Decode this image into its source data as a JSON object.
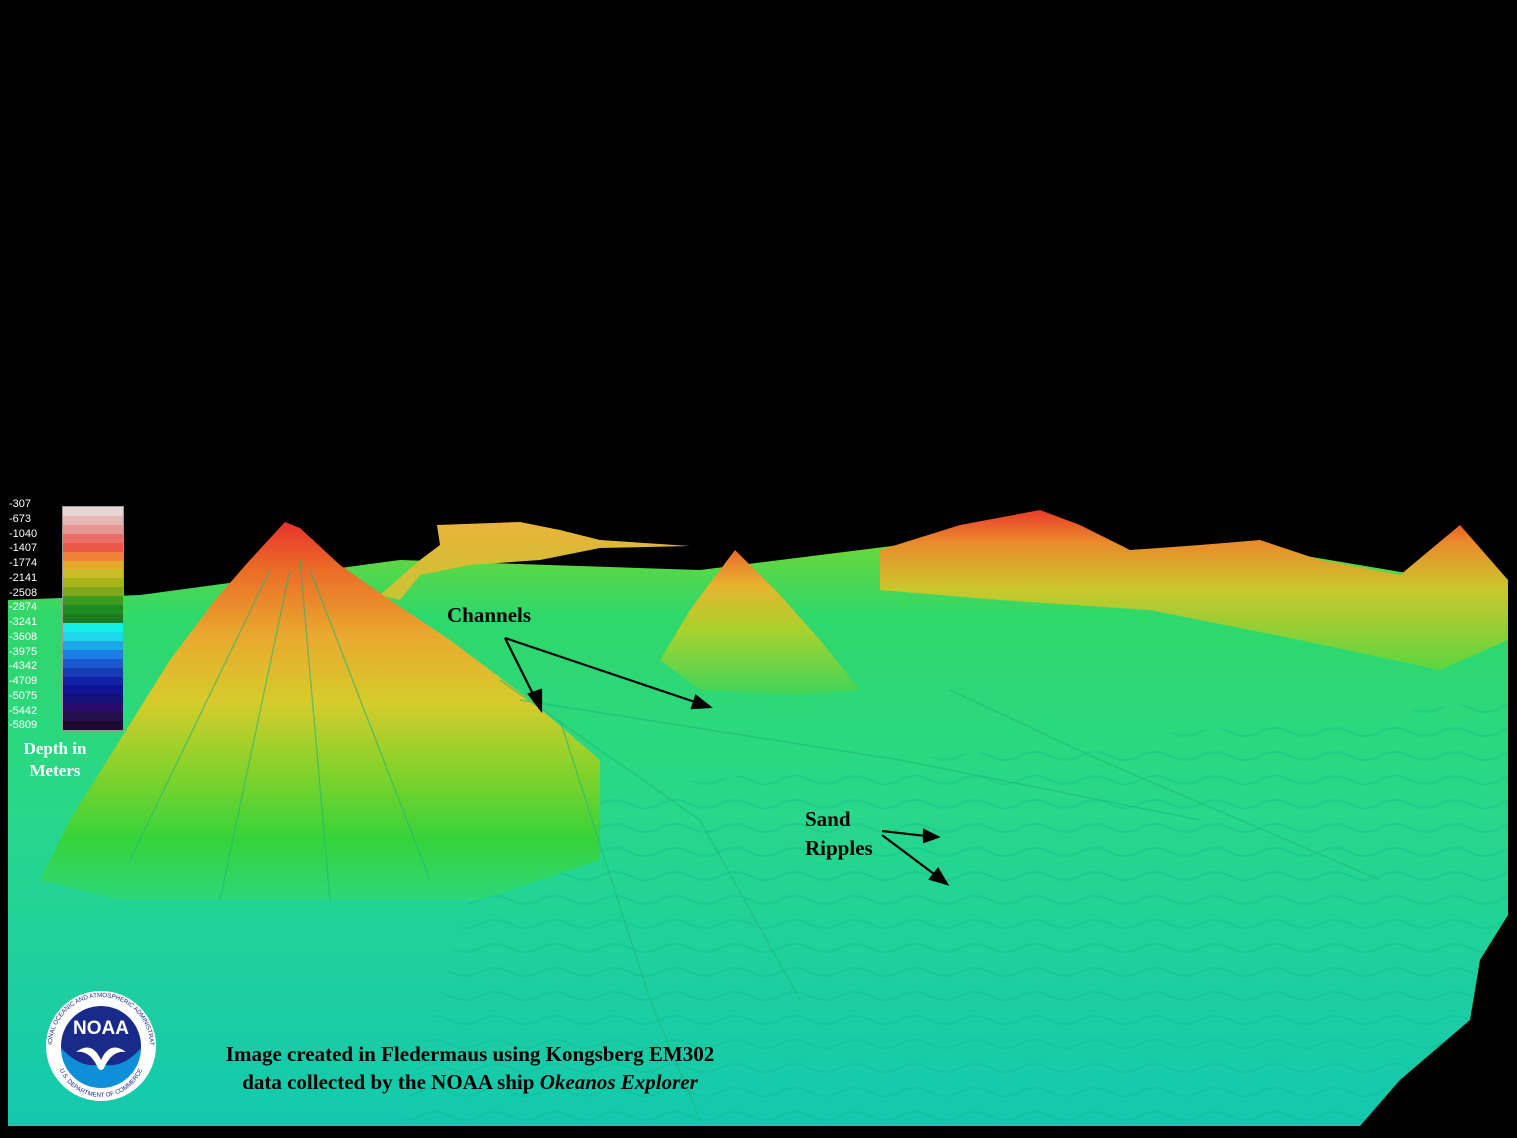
{
  "legend": {
    "title_line1": "Depth in",
    "title_line2": "Meters",
    "ticks": [
      "-307",
      "-673",
      "-1040",
      "-1407",
      "-1774",
      "-2141",
      "-2508",
      "-2874",
      "-3241",
      "-3608",
      "-3975",
      "-4342",
      "-4709",
      "-5075",
      "-5442",
      "-5809"
    ],
    "colors": [
      "#e8d6d6",
      "#e5b7b4",
      "#ea9692",
      "#ea6d66",
      "#ea5848",
      "#ef8236",
      "#e7a92c",
      "#cbbd2a",
      "#a7b51a",
      "#7fa81c",
      "#3b9b1e",
      "#1e8c24",
      "#1b7a22",
      "#14f0e5",
      "#1ed8ea",
      "#1da8ea",
      "#1a7fe4",
      "#1a59cf",
      "#173ab7",
      "#1321a8",
      "#101396",
      "#16107a",
      "#2a0a6c",
      "#24104a",
      "#1c0a30"
    ]
  },
  "annotations": {
    "channels": "Channels",
    "sand_line1": "Sand",
    "sand_line2": "Ripples"
  },
  "credit": {
    "line1": "Image created in Fledermaus using Kongsberg EM302",
    "line2_prefix": "data collected by the NOAA ship ",
    "line2_ship": "Okeanos Explorer"
  },
  "logo": {
    "text": "NOAA",
    "ring_top": "NATIONAL OCEANIC AND ATMOSPHERIC ADMINISTRATION",
    "ring_bottom": "U.S. DEPARTMENT OF COMMERCE"
  },
  "colors": {
    "deep": "#12c9a8",
    "mid": "#2ed870",
    "shallow": "#9fd83a",
    "peak": "#e63a2a"
  }
}
